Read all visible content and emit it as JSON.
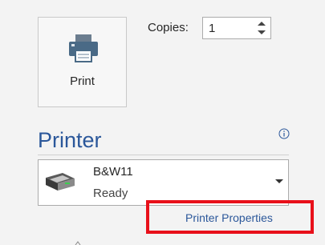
{
  "print": {
    "label": "Print",
    "icon": "printer-icon"
  },
  "copies": {
    "label": "Copies:",
    "value": "1"
  },
  "printer": {
    "heading": "Printer",
    "info_icon": "info-icon",
    "selected": {
      "name": "B&W11",
      "status": "Ready",
      "icon": "printer-device-icon"
    },
    "properties_link": "Printer Properties"
  },
  "colors": {
    "accent": "#2b579a",
    "highlight": "#e8101a",
    "background": "#f3f3f3"
  }
}
